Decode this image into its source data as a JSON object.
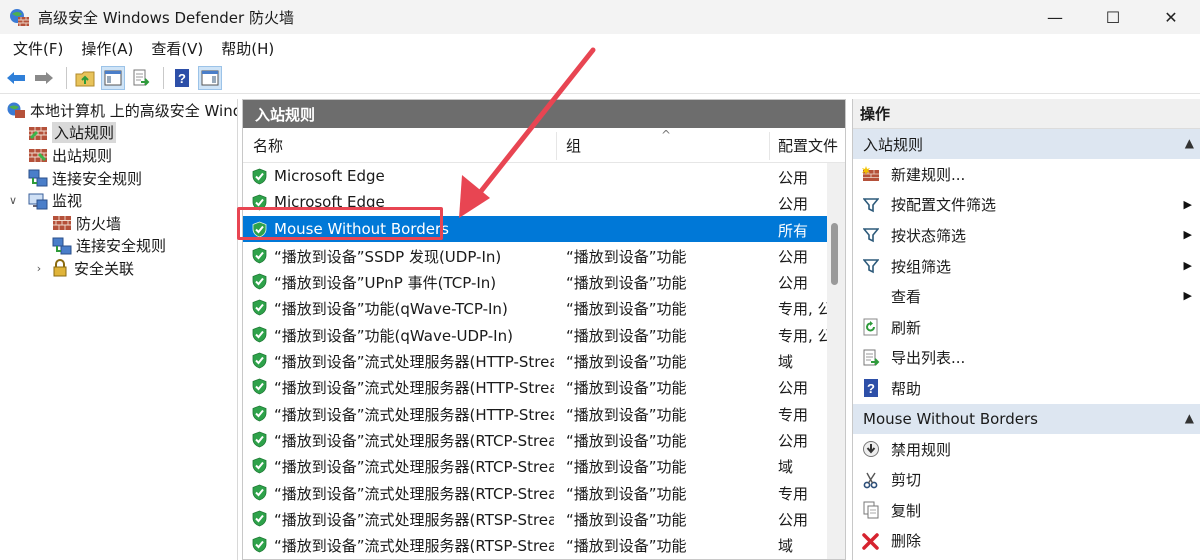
{
  "window": {
    "title": "高级安全 Windows Defender 防火墙",
    "minimize_glyph": "—",
    "maximize_glyph": "☐",
    "close_glyph": "✕"
  },
  "menu": [
    "文件(F)",
    "操作(A)",
    "查看(V)",
    "帮助(H)"
  ],
  "toolbar": {
    "icons": [
      "back-arrow-icon",
      "forward-arrow-icon",
      "up-folder-icon",
      "show-hide-console-tree-icon",
      "export-list-icon",
      "help-icon",
      "show-hide-action-pane-icon"
    ]
  },
  "tree": {
    "root": "本地计算机 上的高级安全 Windows Defender 防火墙",
    "items": [
      {
        "label": "入站规则",
        "level": 1,
        "selected": true
      },
      {
        "label": "出站规则",
        "level": 1
      },
      {
        "label": "连接安全规则",
        "level": 1
      },
      {
        "label": "监视",
        "level": 1,
        "expanded": true
      },
      {
        "label": "防火墙",
        "level": 2
      },
      {
        "label": "连接安全规则",
        "level": 2
      },
      {
        "label": "安全关联",
        "level": 2,
        "collapsed": true
      }
    ]
  },
  "center": {
    "title": "入站规则",
    "columns": {
      "name": "名称",
      "group": "组",
      "profile": "配置文件"
    },
    "rows": [
      {
        "name": "Microsoft Edge",
        "group": "",
        "profile": "公用"
      },
      {
        "name": "Microsoft Edge",
        "group": "",
        "profile": "公用"
      },
      {
        "name": "Mouse Without Borders",
        "group": "",
        "profile": "所有",
        "selected": true
      },
      {
        "name": "“播放到设备”SSDP 发现(UDP-In)",
        "group": "“播放到设备”功能",
        "profile": "公用"
      },
      {
        "name": "“播放到设备”UPnP 事件(TCP-In)",
        "group": "“播放到设备”功能",
        "profile": "公用"
      },
      {
        "name": "“播放到设备”功能(qWave-TCP-In)",
        "group": "“播放到设备”功能",
        "profile": "专用, 公用"
      },
      {
        "name": "“播放到设备”功能(qWave-UDP-In)",
        "group": "“播放到设备”功能",
        "profile": "专用, 公用"
      },
      {
        "name": "“播放到设备”流式处理服务器(HTTP-Streaming-In)",
        "group": "“播放到设备”功能",
        "profile": "域"
      },
      {
        "name": "“播放到设备”流式处理服务器(HTTP-Streaming-In)",
        "group": "“播放到设备”功能",
        "profile": "公用"
      },
      {
        "name": "“播放到设备”流式处理服务器(HTTP-Streaming-In)",
        "group": "“播放到设备”功能",
        "profile": "专用"
      },
      {
        "name": "“播放到设备”流式处理服务器(RTCP-Streaming-In)",
        "group": "“播放到设备”功能",
        "profile": "公用"
      },
      {
        "name": "“播放到设备”流式处理服务器(RTCP-Streaming-In)",
        "group": "“播放到设备”功能",
        "profile": "域"
      },
      {
        "name": "“播放到设备”流式处理服务器(RTCP-Streaming-In)",
        "group": "“播放到设备”功能",
        "profile": "专用"
      },
      {
        "name": "“播放到设备”流式处理服务器(RTSP-Streaming-In)",
        "group": "“播放到设备”功能",
        "profile": "公用"
      },
      {
        "name": "“播放到设备”流式处理服务器(RTSP-Streaming-In)",
        "group": "“播放到设备”功能",
        "profile": "域"
      }
    ]
  },
  "actions": {
    "title": "操作",
    "section1": {
      "label": "入站规则",
      "items": [
        {
          "label": "新建规则...",
          "icon": "new-rule-icon"
        },
        {
          "label": "按配置文件筛选",
          "icon": "filter-icon",
          "submenu": true
        },
        {
          "label": "按状态筛选",
          "icon": "filter-icon",
          "submenu": true
        },
        {
          "label": "按组筛选",
          "icon": "filter-icon",
          "submenu": true
        },
        {
          "label": "查看",
          "icon": "",
          "submenu": true
        },
        {
          "label": "刷新",
          "icon": "refresh-icon"
        },
        {
          "label": "导出列表...",
          "icon": "export-list-icon"
        },
        {
          "label": "帮助",
          "icon": "help-icon"
        }
      ]
    },
    "section2": {
      "label": "Mouse Without Borders",
      "items": [
        {
          "label": "禁用规则",
          "icon": "disable-rule-icon"
        },
        {
          "label": "剪切",
          "icon": "cut-icon"
        },
        {
          "label": "复制",
          "icon": "copy-icon"
        },
        {
          "label": "删除",
          "icon": "delete-icon"
        }
      ]
    }
  },
  "colors": {
    "selection": "#0078d7",
    "panel_header": "#6d6d6d",
    "annotation": "#e84552",
    "section_header": "#dde6f1"
  }
}
